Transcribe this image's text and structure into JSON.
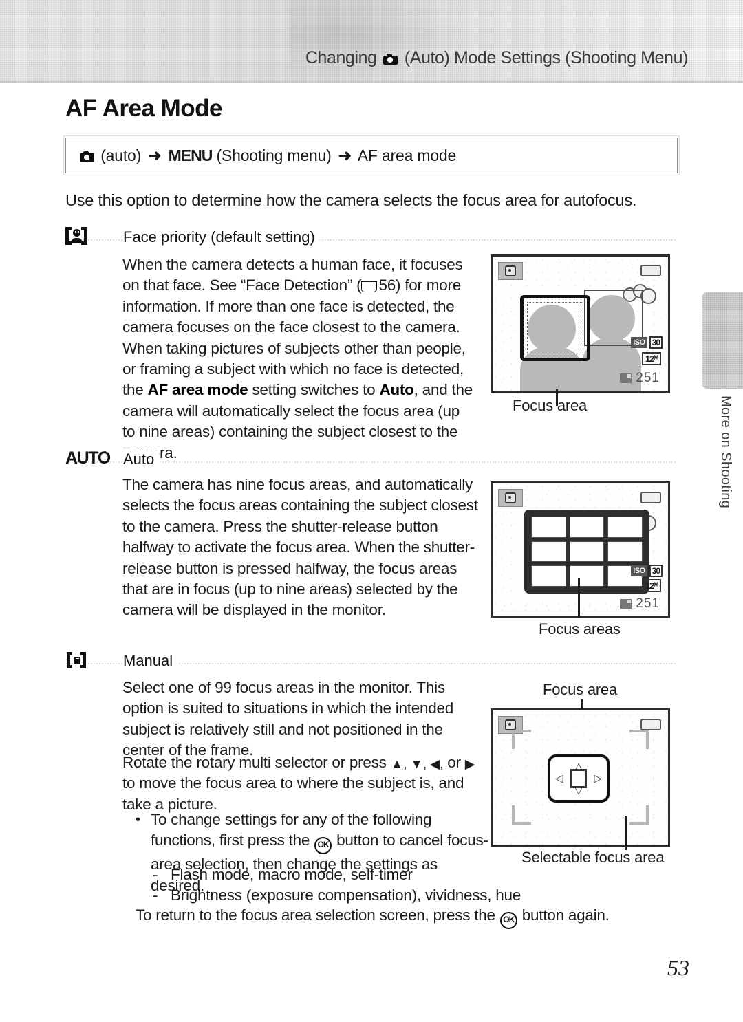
{
  "header": {
    "running_head_before": "Changing",
    "running_head_after": "(Auto) Mode Settings (Shooting Menu)",
    "camera_icon": "camera-icon"
  },
  "page_title": "AF Area Mode",
  "nav_box": {
    "auto_label": "(auto)",
    "arrow": "➜",
    "menu_label": "MENU",
    "menu_paren": "(Shooting menu)",
    "target": "AF area mode"
  },
  "intro": "Use this option to determine how the camera selects the focus area for autofocus.",
  "sections": [
    {
      "icon": "face-priority-icon",
      "title": "Face priority (default setting)",
      "body": "When the camera detects a human face, it focuses on that face. See “Face Detection” (  56) for more information. If more than one face is detected, the camera focuses on the face closest to the camera. When taking pictures of subjects other than people, or framing a subject with which no face is detected, the AF area mode setting switches to Auto, and the camera will automatically select the focus area (up to nine areas) containing the subject closest to the camera.",
      "body_segments": {
        "p1": "When the camera detects a human face, it focuses on that face. See “Face Detection” (",
        "page_ref": "56",
        "p2": ") for more information. If more than one face is detected, the camera focuses on the face closest to the camera. When taking pictures of subjects other than people, or framing a subject with which no face is detected, the ",
        "bold1": "AF area mode",
        "p3": " setting switches to ",
        "bold2": "Auto",
        "p4": ", and the camera will automatically select the focus area (up to nine areas) containing the subject closest to the camera."
      }
    },
    {
      "icon": "auto-icon",
      "icon_text": "AUTO",
      "title": "Auto",
      "body": "The camera has nine focus areas, and automatically selects the focus areas containing the subject closest to the camera. Press the shutter-release button halfway to activate the focus area. When the shutter-release button is pressed halfway, the focus areas that are in focus (up to nine areas) selected by the camera will be displayed in the monitor."
    },
    {
      "icon": "manual-icon",
      "title": "Manual",
      "body_p1": "Select one of 99 focus areas in the monitor. This option is suited to situations in which the intended subject is relatively still and not positioned in the center of the frame.",
      "body_p2_a": "Rotate the rotary multi selector or press ",
      "body_p2_arrows": "▲, ▼, ◀,",
      "body_p2_b": " or ",
      "body_p2_arrow_right": "▶",
      "body_p2_c": " to move the focus area to where the subject is, and take a picture.",
      "bullets": [
        {
          "marker": "•",
          "text_a": "To change settings for any of the following functions, first press the ",
          "ok_glyph": "OK",
          "text_b": " button to cancel focus-area selection, then change the settings as desired."
        }
      ],
      "sub_bullets": [
        {
          "marker": "-",
          "text": "Flash mode, macro mode, self-timer"
        },
        {
          "marker": "-",
          "text": "Brightness (exposure compensation), vividness, hue"
        }
      ],
      "closing_a": "To return to the focus area selection screen, press the ",
      "closing_ok": "OK",
      "closing_b": " button again."
    }
  ],
  "illustrations": [
    {
      "name": "face-priority-monitor",
      "caption": "Focus area",
      "osd": {
        "iso_a": "ISO",
        "iso_b": "30",
        "megapixels": "12ᴹ",
        "shots_remaining": "251"
      }
    },
    {
      "name": "auto-nine-areas-monitor",
      "caption": "Focus areas",
      "osd": {
        "iso_a": "ISO",
        "iso_b": "30",
        "megapixels": "12ᴹ",
        "shots_remaining": "251"
      }
    },
    {
      "name": "manual-selectable-monitor",
      "caption_top": "Focus area",
      "caption_bottom": "Selectable focus area"
    }
  ],
  "side_tab": {
    "label": "More on Shooting"
  },
  "page_number": "53",
  "colors": {
    "ink": "#1c1c1c",
    "band": "#e4e4e4",
    "tab": "#d2d2d2"
  }
}
